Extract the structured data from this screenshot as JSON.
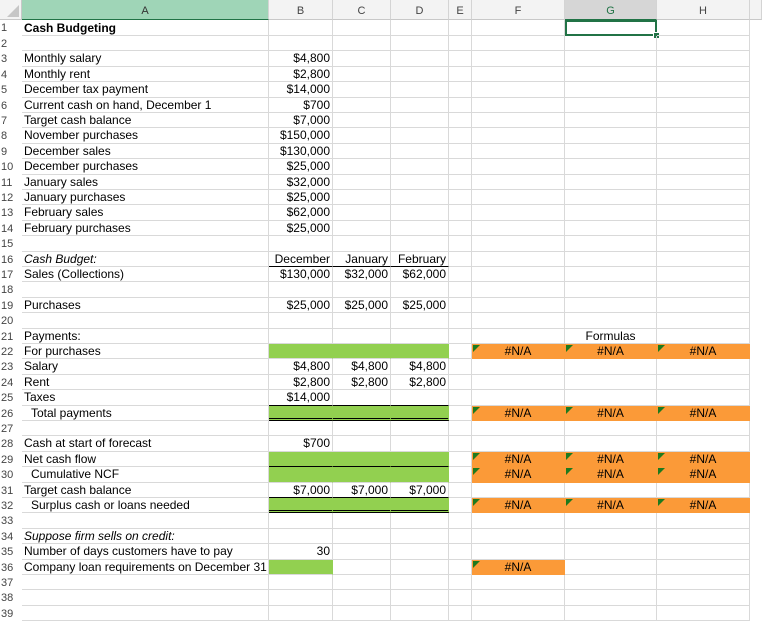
{
  "spreadsheet": {
    "columns": [
      "A",
      "B",
      "C",
      "D",
      "E",
      "F",
      "G",
      "H"
    ],
    "selected_cell": "G1",
    "rows": [
      {
        "n": "1",
        "a": "Cash Budgeting"
      },
      {
        "n": "2",
        "a": ""
      },
      {
        "n": "3",
        "a": "Monthly salary",
        "b": "$4,800"
      },
      {
        "n": "4",
        "a": "Monthly rent",
        "b": "$2,800"
      },
      {
        "n": "5",
        "a": "December tax payment",
        "b": "$14,000"
      },
      {
        "n": "6",
        "a": "Current cash on hand, December 1",
        "b": "$700"
      },
      {
        "n": "7",
        "a": "Target cash balance",
        "b": "$7,000"
      },
      {
        "n": "8",
        "a": "November purchases",
        "b": "$150,000"
      },
      {
        "n": "9",
        "a": "December sales",
        "b": "$130,000"
      },
      {
        "n": "10",
        "a": "December purchases",
        "b": "$25,000"
      },
      {
        "n": "11",
        "a": "January sales",
        "b": "$32,000"
      },
      {
        "n": "12",
        "a": "January purchases",
        "b": "$25,000"
      },
      {
        "n": "13",
        "a": "February sales",
        "b": "$62,000"
      },
      {
        "n": "14",
        "a": "February purchases",
        "b": "$25,000"
      },
      {
        "n": "15",
        "a": ""
      },
      {
        "n": "16",
        "a": "Cash Budget:",
        "b": "December",
        "c": "January",
        "d": "February"
      },
      {
        "n": "17",
        "a": "Sales (Collections)",
        "b": "$130,000",
        "c": "$32,000",
        "d": "$62,000"
      },
      {
        "n": "18",
        "a": ""
      },
      {
        "n": "19",
        "a": "Purchases",
        "b": "$25,000",
        "c": "$25,000",
        "d": "$25,000"
      },
      {
        "n": "20",
        "a": ""
      },
      {
        "n": "21",
        "a": "Payments:",
        "g": "Formulas"
      },
      {
        "n": "22",
        "a": "For purchases",
        "f": "#N/A",
        "g": "#N/A",
        "h": "#N/A"
      },
      {
        "n": "23",
        "a": "Salary",
        "b": "$4,800",
        "c": "$4,800",
        "d": "$4,800"
      },
      {
        "n": "24",
        "a": "Rent",
        "b": "$2,800",
        "c": "$2,800",
        "d": "$2,800"
      },
      {
        "n": "25",
        "a": "Taxes",
        "b": "$14,000"
      },
      {
        "n": "26",
        "a": "Total payments",
        "f": "#N/A",
        "g": "#N/A",
        "h": "#N/A"
      },
      {
        "n": "27",
        "a": ""
      },
      {
        "n": "28",
        "a": "Cash at start of forecast",
        "b": "$700"
      },
      {
        "n": "29",
        "a": "Net cash flow",
        "f": "#N/A",
        "g": "#N/A",
        "h": "#N/A"
      },
      {
        "n": "30",
        "a": "Cumulative NCF",
        "f": "#N/A",
        "g": "#N/A",
        "h": "#N/A"
      },
      {
        "n": "31",
        "a": "Target cash balance",
        "b": "$7,000",
        "c": "$7,000",
        "d": "$7,000"
      },
      {
        "n": "32",
        "a": "Surplus cash or loans needed",
        "f": "#N/A",
        "g": "#N/A",
        "h": "#N/A"
      },
      {
        "n": "33",
        "a": ""
      },
      {
        "n": "34",
        "a": "Suppose firm sells on credit:"
      },
      {
        "n": "35",
        "a": "Number of days customers have to pay",
        "b": "30"
      },
      {
        "n": "36",
        "a": "Company loan requirements on December 31",
        "f": "#N/A"
      },
      {
        "n": "37",
        "a": ""
      },
      {
        "n": "38",
        "a": ""
      },
      {
        "n": "39",
        "a": ""
      }
    ]
  },
  "colors": {
    "input_fill": "#92d050",
    "error_fill": "#fb9a38",
    "selection": "#217346"
  }
}
